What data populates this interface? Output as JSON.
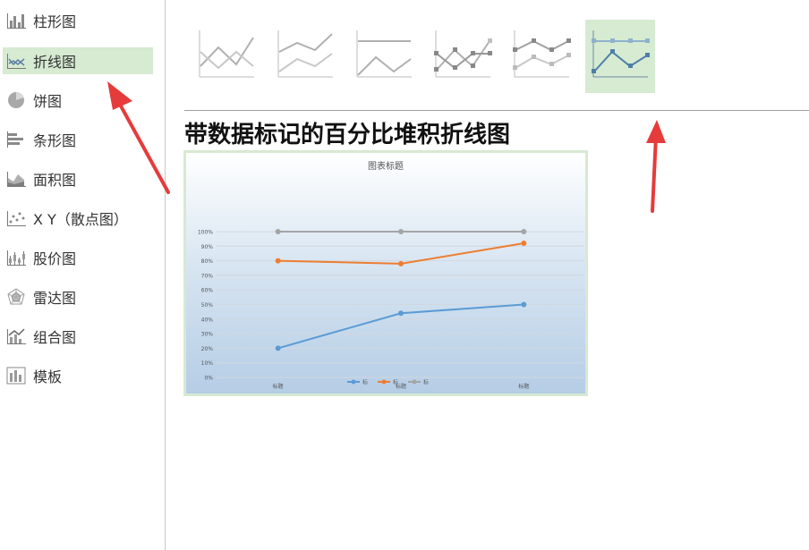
{
  "sidebar": {
    "items": [
      {
        "label": "柱形图",
        "icon": "column-chart-icon"
      },
      {
        "label": "折线图",
        "icon": "line-chart-icon"
      },
      {
        "label": "饼图",
        "icon": "pie-chart-icon"
      },
      {
        "label": "条形图",
        "icon": "bar-chart-icon"
      },
      {
        "label": "面积图",
        "icon": "area-chart-icon"
      },
      {
        "label": "X Y（散点图）",
        "icon": "scatter-chart-icon"
      },
      {
        "label": "股价图",
        "icon": "stock-chart-icon"
      },
      {
        "label": "雷达图",
        "icon": "radar-chart-icon"
      },
      {
        "label": "组合图",
        "icon": "combo-chart-icon"
      },
      {
        "label": "模板",
        "icon": "template-icon"
      }
    ],
    "selected_index": 1
  },
  "subtypes": {
    "count": 6,
    "selected_index": 5
  },
  "chart_type_title": "带数据标记的百分比堆积折线图",
  "colors": {
    "accent_selected": "#d6ebd2",
    "series_blue": "#5b9bd5",
    "series_orange": "#ed7d31",
    "series_gray": "#a5a5a5",
    "arrow_red": "#e63b3b"
  },
  "chart_data": {
    "type": "line",
    "title": "图表标题",
    "categories": [
      "标题",
      "标题",
      "标题"
    ],
    "series": [
      {
        "name": "标",
        "values": [
          20,
          44,
          50
        ]
      },
      {
        "name": "标",
        "values": [
          80,
          78,
          92
        ]
      },
      {
        "name": "标",
        "values": [
          100,
          100,
          100
        ]
      }
    ],
    "ylim": [
      0,
      100
    ],
    "yticks": [
      "0%",
      "10%",
      "20%",
      "30%",
      "40%",
      "50%",
      "60%",
      "70%",
      "80%",
      "90%",
      "100%"
    ],
    "grid": true,
    "legend": "bottom"
  }
}
